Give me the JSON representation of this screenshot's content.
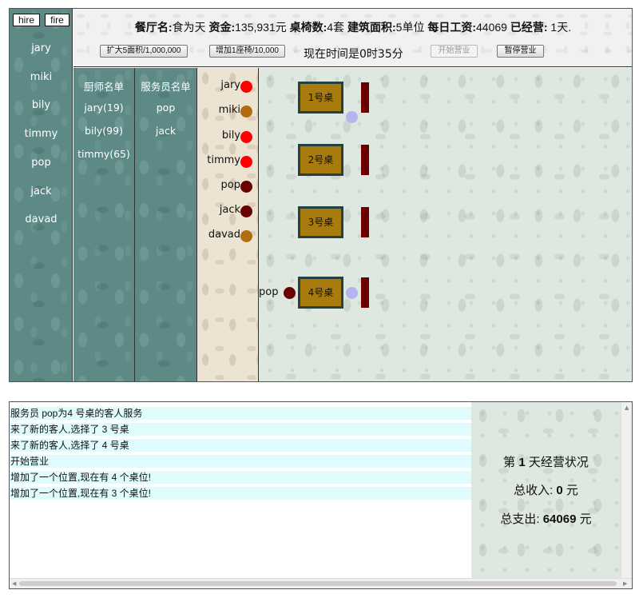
{
  "staff": {
    "hire_label": "hire",
    "fire_label": "fire",
    "names": [
      "jary",
      "miki",
      "bily",
      "timmy",
      "pop",
      "jack",
      "davad"
    ]
  },
  "header": {
    "restaurant_label": "餐厅名:",
    "restaurant_name": "食为天",
    "funds_label": "资金:",
    "funds_value": "135,931元",
    "tables_label": "桌椅数:",
    "tables_value": "4套",
    "area_label": "建筑面积:",
    "area_value": "5单位",
    "wage_label": "每日工资:",
    "wage_value": "44069",
    "days_label": "已经营:",
    "days_value": "1天.",
    "expand_button": "扩大5面积/1,000,000",
    "add_seat_button": "增加1座椅/10,000",
    "time_text": "现在时间是0时35分",
    "start_button": "开始营业",
    "pause_button": "暂停营业"
  },
  "chefs": {
    "title": "厨师名单",
    "items": [
      "jary(19)",
      "bily(99)",
      "timmy(65)"
    ]
  },
  "waiters": {
    "title": "服务员名单",
    "items": [
      "pop",
      "jack"
    ]
  },
  "customers": [
    {
      "name": "jary",
      "color": "#ff0000"
    },
    {
      "name": "miki",
      "color": "#b36d0f"
    },
    {
      "name": "bily",
      "color": "#ff0000"
    },
    {
      "name": "timmy",
      "color": "#ff0000"
    },
    {
      "name": "pop",
      "color": "#6a0000"
    },
    {
      "name": "jack",
      "color": "#6a0000"
    },
    {
      "name": "davad",
      "color": "#b36d0f"
    }
  ],
  "hall": {
    "tables": [
      "1号桌",
      "2号桌",
      "3号桌",
      "4号桌"
    ],
    "serving_waiter": "pop"
  },
  "log": [
    "服务员 pop为4 号桌的客人服务",
    "来了新的客人,选择了 3 号桌",
    "来了新的客人,选择了 4 号桌",
    "开始营业",
    "增加了一个位置,现在有 4 个桌位!",
    "增加了一个位置,现在有 3 个桌位!"
  ],
  "stats": {
    "day_prefix": "第",
    "day_number": "1",
    "day_suffix": "天经营状况",
    "income_label": "总收入:",
    "income_value": "0",
    "income_unit": "元",
    "expense_label": "总支出:",
    "expense_value": "64069",
    "expense_unit": "元"
  }
}
